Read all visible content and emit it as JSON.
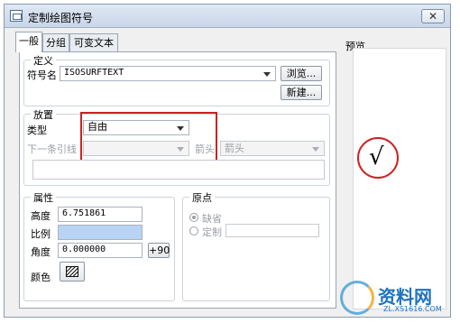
{
  "window": {
    "title": "定制绘图符号",
    "close_glyph": "✕"
  },
  "tabs": [
    {
      "label": "一般"
    },
    {
      "label": "分组"
    },
    {
      "label": "可变文本"
    }
  ],
  "definition": {
    "legend": "定义",
    "symbol_name_label": "符号名",
    "symbol_name_value": "ISOSURFTEXT",
    "browse_button": "浏览...",
    "new_button": "新建..."
  },
  "placement": {
    "legend": "放置",
    "type_label": "类型",
    "type_value": "自由",
    "next_leader_label": "下一条引线",
    "arrow_label": "箭头",
    "arrow_value": "箭头"
  },
  "properties": {
    "legend": "属性",
    "height_label": "高度",
    "height_value": "6.751861",
    "scale_label": "比例",
    "scale_value": "",
    "angle_label": "角度",
    "angle_value": "0.000000",
    "rotate_button": "+90",
    "color_label": "颜色"
  },
  "origin": {
    "legend": "原点",
    "default_label": "缺省",
    "custom_label": "定制",
    "default_selected": true
  },
  "preview": {
    "label": "预览",
    "symbol": "√"
  },
  "watermark": {
    "brand": "资料网",
    "url": "ZL.XS1616.COM"
  },
  "colors": {
    "highlight": "#cc2222",
    "title_bar": "#d3deec",
    "scale_field": "#b8d4f2"
  }
}
